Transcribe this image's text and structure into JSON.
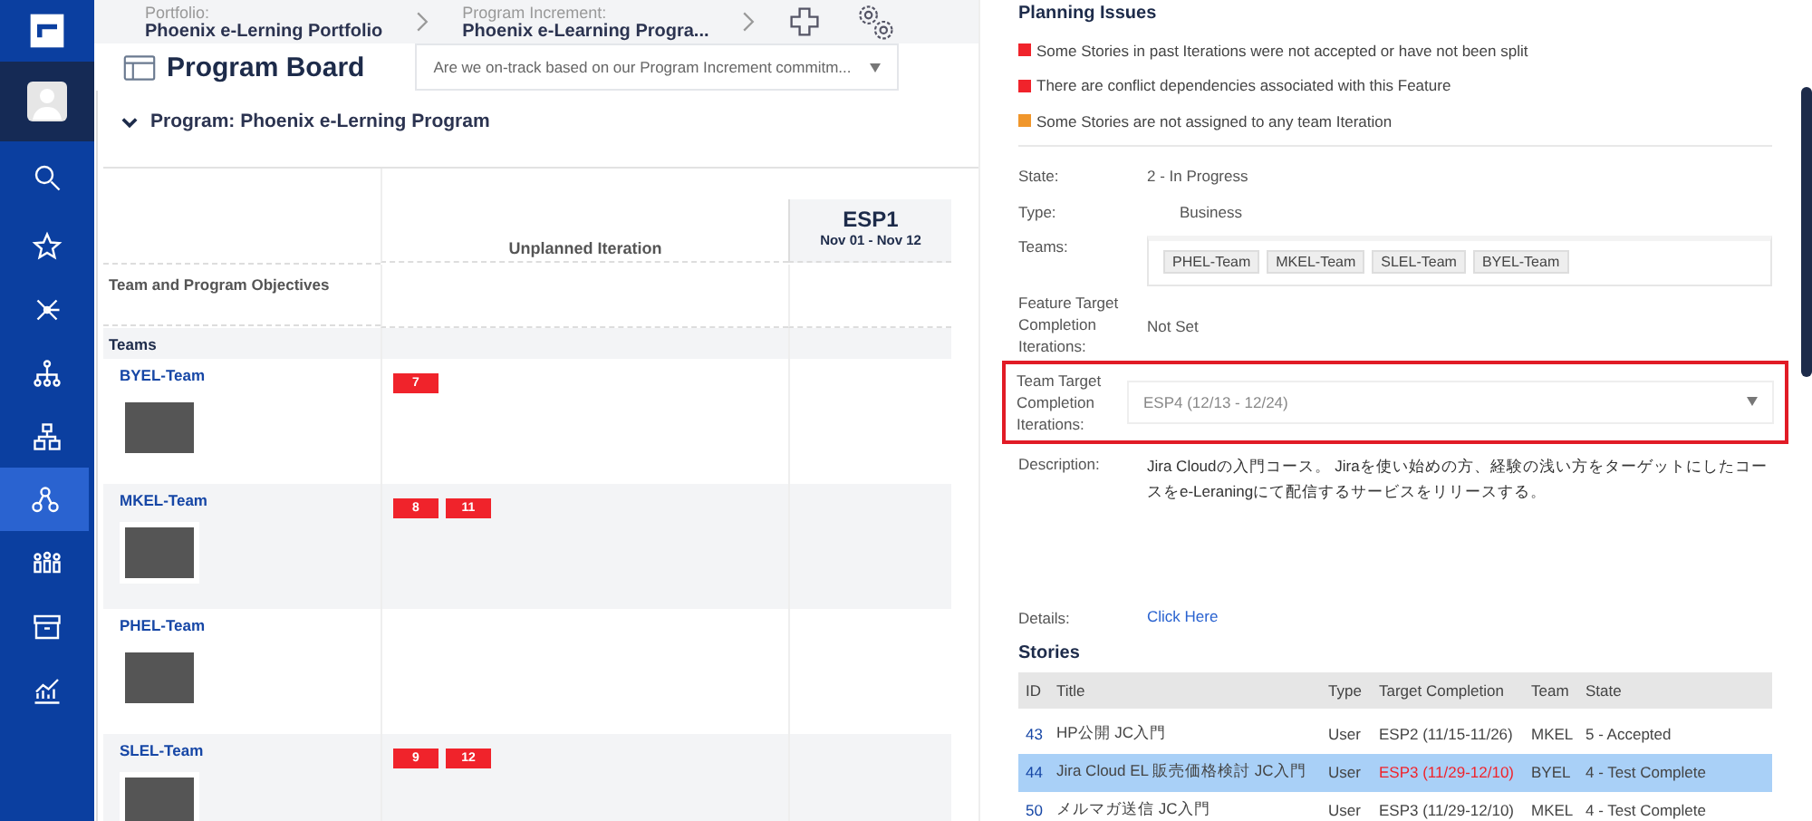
{
  "sidebar": {
    "items": [
      {
        "kind": "logo",
        "selected": false
      },
      {
        "kind": "avatar",
        "selected": false
      },
      {
        "kind": "search",
        "selected": false
      },
      {
        "kind": "star",
        "selected": false
      },
      {
        "kind": "network",
        "selected": false
      },
      {
        "kind": "hierarchy",
        "selected": false
      },
      {
        "kind": "boxes",
        "selected": false
      },
      {
        "kind": "program",
        "selected": true
      },
      {
        "kind": "teams",
        "selected": false
      },
      {
        "kind": "archive",
        "selected": false
      },
      {
        "kind": "chart",
        "selected": false
      }
    ]
  },
  "breadcrumbs": [
    {
      "label": "Portfolio:",
      "value": "Phoenix e-Lerning Portfolio"
    },
    {
      "label": "Program Increment:",
      "value": "Phoenix e-Learning Progra..."
    }
  ],
  "page": {
    "title": "Program Board",
    "dropdown": "Are we on-track based on our Program Increment commitm..."
  },
  "program": {
    "title": "Program: Phoenix e-Lerning Program",
    "expanded": true
  },
  "board": {
    "unplanned_header": "Unplanned Iteration",
    "iterations": [
      {
        "name": "ESP1",
        "dates": "Nov 01 - Nov 12"
      }
    ],
    "objectives_label": "Team and Program Objectives",
    "teams_label": "Teams",
    "teams": [
      {
        "name": "BYEL-Team",
        "features": [
          "7"
        ]
      },
      {
        "name": "MKEL-Team",
        "features": [
          "8",
          "11"
        ]
      },
      {
        "name": "PHEL-Team"
      },
      {
        "name": "SLEL-Team",
        "features": [
          "9",
          "12"
        ]
      }
    ]
  },
  "panel": {
    "issues_title": "Planning Issues",
    "issues": [
      {
        "text": "Some Stories in past Iterations were not accepted or have not been split",
        "color": "#f0232b"
      },
      {
        "text": "There are conflict dependencies associated with this Feature",
        "color": "#f0232b"
      },
      {
        "text": "Some Stories are not assigned to any team Iteration",
        "color": "#f0962b"
      }
    ],
    "state_label": "State:",
    "state": "2 - In Progress",
    "type_label": "Type:",
    "type": "Business",
    "teams_label": "Teams:",
    "teams": [
      "PHEL-Team",
      "MKEL-Team",
      "SLEL-Team",
      "BYEL-Team"
    ],
    "feature_target_label": "Feature Target Completion Iterations:",
    "feature_target": "Not Set",
    "team_target_label": "Team Target Completion Iterations:",
    "team_target": "ESP4 (12/13 - 12/24)",
    "team_target_highlighted": true,
    "description_label": "Description:",
    "description": "Jira Cloudの入門コース。 Jiraを使い始めの方、経験の浅い方をターゲットにしたコースをe-Leraningにて配信するサービスをリリースする。",
    "details_label": "Details:",
    "details_link": "Click Here",
    "stories_title": "Stories",
    "stories": {
      "columns": [
        "ID",
        "Title",
        "Type",
        "Target Completion",
        "Team",
        "State"
      ],
      "rows": [
        {
          "id": "43",
          "title": "HP公開 JC入門",
          "type": "User",
          "target": "ESP2 (11/15-11/26)",
          "late": false,
          "team": "MKEL",
          "state": "5 - Accepted",
          "selected": false
        },
        {
          "id": "44",
          "title": "Jira Cloud EL 販売価格検討 JC入門",
          "type": "User",
          "target": "ESP3 (11/29-12/10)",
          "late": true,
          "team": "BYEL",
          "state": "4 - Test Complete",
          "selected": true
        },
        {
          "id": "50",
          "title": "メルマガ送信 JC入門",
          "type": "User",
          "target": "ESP3 (11/29-12/10)",
          "late": false,
          "team": "MKEL",
          "state": "4 - Test Complete",
          "selected": false
        }
      ]
    }
  }
}
